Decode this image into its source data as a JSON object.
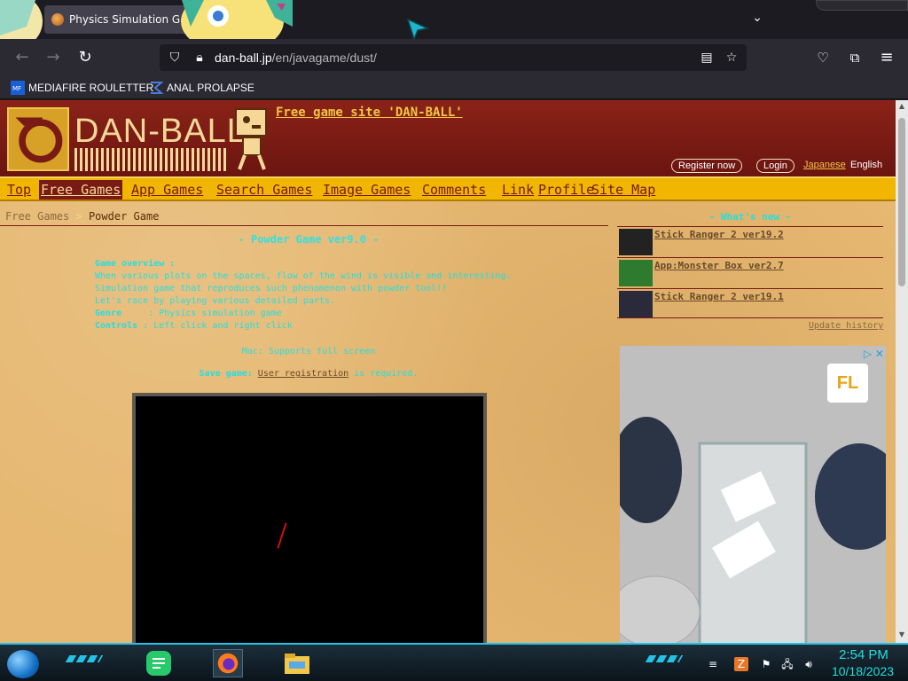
{
  "browser": {
    "tab_title": "Physics Simulation Gam",
    "url_host": "dan-ball.jp",
    "url_path": "/en/javagame/dust/",
    "bookmarks": [
      {
        "label": "MEDIAFIRE ROULETTER"
      },
      {
        "label": "ANAL PROLAPSE"
      }
    ]
  },
  "site": {
    "logo_text": "DAN-BALL",
    "free_site_link": "Free game site 'DAN-BALL'",
    "register_label": "Register now",
    "login_label": "Login",
    "lang_japanese": "Japanese",
    "lang_english": "English",
    "menu": [
      {
        "label": "Top"
      },
      {
        "label": "Free Games"
      },
      {
        "label": "App Games"
      },
      {
        "label": "Search Games"
      },
      {
        "label": "Image Games"
      },
      {
        "label": "Comments"
      },
      {
        "label": "Link"
      },
      {
        "label": "Profile"
      },
      {
        "label": "Site Map"
      }
    ],
    "active_menu": "Free Games"
  },
  "breadcrumb": {
    "parent": "Free Games",
    "separator": ">",
    "current": "Powder Game"
  },
  "game": {
    "title": "- Powder Game ver9.0 -",
    "overview_label": "Game overview :",
    "overview_lines": [
      "When various plots on the spaces, flow of the wind is visible and interesting.",
      "Simulation game that reproduces such phenomenon with powder tool!!",
      "Let's race by playing various detailed parts."
    ],
    "genre_label": "Genre",
    "genre_value": ": Physics simulation game",
    "controls_label": "Controls",
    "controls_value": ": Left click and right click",
    "mac_note": "Mac: Supports full screen",
    "save_label": "Save game:",
    "save_link": "User registration",
    "save_suffix": " is required."
  },
  "sidebar": {
    "whats_new": "- What's new -",
    "news": [
      {
        "label": "Stick Ranger 2 ver19.2"
      },
      {
        "label": "App:Monster Box ver2.7"
      },
      {
        "label": "Stick Ranger 2 ver19.1"
      }
    ],
    "update_history": "Update history",
    "ad_logo_main": "F",
    "ad_logo_accent": "L",
    "ad_controls": "▷ ✕"
  },
  "taskbar": {
    "time": "2:54 PM",
    "date": "10/18/2023"
  },
  "colors": {
    "header_red": "#7a1a14",
    "menu_gold": "#f0b600",
    "cyan_text": "#22dfe0",
    "page_tan": "#e6b871"
  }
}
